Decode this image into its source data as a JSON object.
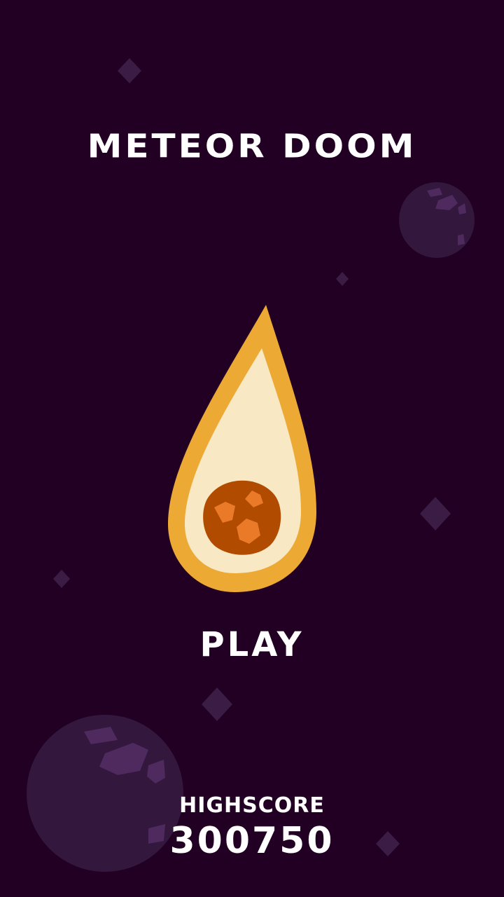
{
  "game": {
    "title": "METEOR DOOM",
    "play_label": "PLAY",
    "highscore_label": "HIGHSCORE",
    "highscore_value": "300750"
  },
  "colors": {
    "background": "#220023",
    "planet": "#33173d",
    "planet_crater": "#4e2a5e",
    "star": "#3a1c45",
    "flame_outer": "#eca934",
    "flame_inner": "#f9e8c4",
    "meteor": "#b14b00",
    "meteor_spot": "#ea7a27",
    "text": "#ffffff"
  }
}
